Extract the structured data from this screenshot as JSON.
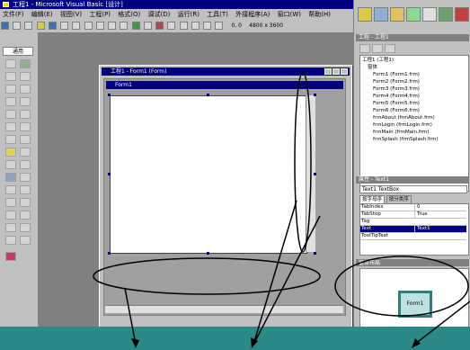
{
  "window": {
    "title": "工程1 - Microsoft Visual Basic [设计]"
  },
  "menubar": {
    "items": [
      "文件(F)",
      "编辑(E)",
      "视图(V)",
      "工程(P)",
      "格式(O)",
      "调试(D)",
      "运行(R)",
      "工具(T)",
      "外接程序(A)",
      "窗口(W)",
      "帮助(H)"
    ]
  },
  "toolbar": {
    "coords": "0, 0",
    "size": "4800 x 3600"
  },
  "toolbox": {
    "header": "通用"
  },
  "form_window": {
    "title": "工程1 - Form1 (Form)",
    "form_caption": "Form1"
  },
  "project_explorer": {
    "header": "工程 - 工程1",
    "items": [
      "工程1 (工程1)",
      "窗体",
      "Form1 (Form1.frm)",
      "Form2 (Form2.frm)",
      "Form3 (Form3.frm)",
      "Form4 (Form4.frm)",
      "Form5 (Form5.frm)",
      "Form6 (Form6.frm)",
      "frmAbout (frmAbout.frm)",
      "frmLogin (frmLogin.frm)",
      "frmMain (frmMain.frm)",
      "frmSplash (frmSplash.frm)"
    ]
  },
  "properties": {
    "header": "属性 - Text1",
    "object_combo": "Text1 TextBox",
    "tabs": [
      "按字母序",
      "按分类序"
    ],
    "rows": [
      {
        "name": "TabIndex",
        "value": "0"
      },
      {
        "name": "TabStop",
        "value": "True"
      },
      {
        "name": "Tag",
        "value": ""
      },
      {
        "name": "Text",
        "value": "Text1"
      },
      {
        "name": "ToolTipText",
        "value": ""
      }
    ],
    "selected_row": 3
  },
  "form_layout": {
    "header": "窗体布局",
    "form_label": "Form1"
  },
  "colors": {
    "title_blue": "#000080",
    "status_teal": "#2b8a86",
    "annotation": "#000000"
  }
}
